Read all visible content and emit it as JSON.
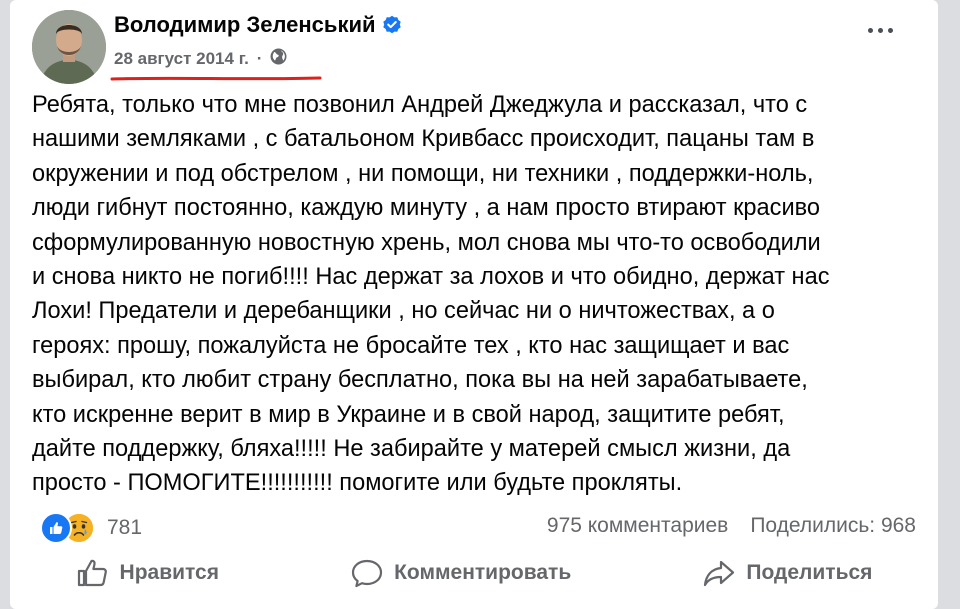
{
  "author": {
    "name": "Володимир Зеленський",
    "verified_icon": "verified-badge-icon",
    "accent": "#1877f2"
  },
  "post": {
    "date": "28 август 2014 г.",
    "separator": "·",
    "privacy_icon": "globe-icon",
    "text_lines": [
      "Ребята, только что мне позвонил Андрей Джеджула и рассказал, что с",
      "нашими земляками , с батальоном Кривбасс происходит, пацаны там в",
      "окружении и под обстрелом , ни помощи, ни техники , поддержки-ноль,",
      "люди гибнут постоянно, каждую минуту , а нам просто втирают красиво",
      "сформулированную новостную хрень, мол снова мы что-то освободили",
      "и снова никто не погиб!!!! Нас держат за лохов и что обидно, держат нас",
      "Лохи! Предатели и деребанщики , но сейчас ни о ничтожествах, а о",
      "героях: прошу, пожалуйста не бросайте тех , кто нас защищает и вас",
      "выбирал, кто любит страну бесплатно, пока вы на ней зарабатываете,",
      "кто искренне верит в мир в Украине и в свой народ, защитите ребят,",
      "дайте поддержку, бляха!!!!! Не забирайте у матерей смысл жизни, да",
      "просто - ПОМОГИТЕ!!!!!!!!!!!  помогите или будьте прокляты."
    ]
  },
  "stats": {
    "reactions_count": "781",
    "reaction_icons": [
      "like-icon",
      "sad-icon"
    ],
    "comments": "975 комментариев",
    "shares": "Поделились: 968"
  },
  "actions": {
    "like": "Нравится",
    "comment": "Комментировать",
    "share": "Поделиться"
  },
  "colors": {
    "underline": "#e0211b",
    "secondary_text": "#65676b"
  }
}
